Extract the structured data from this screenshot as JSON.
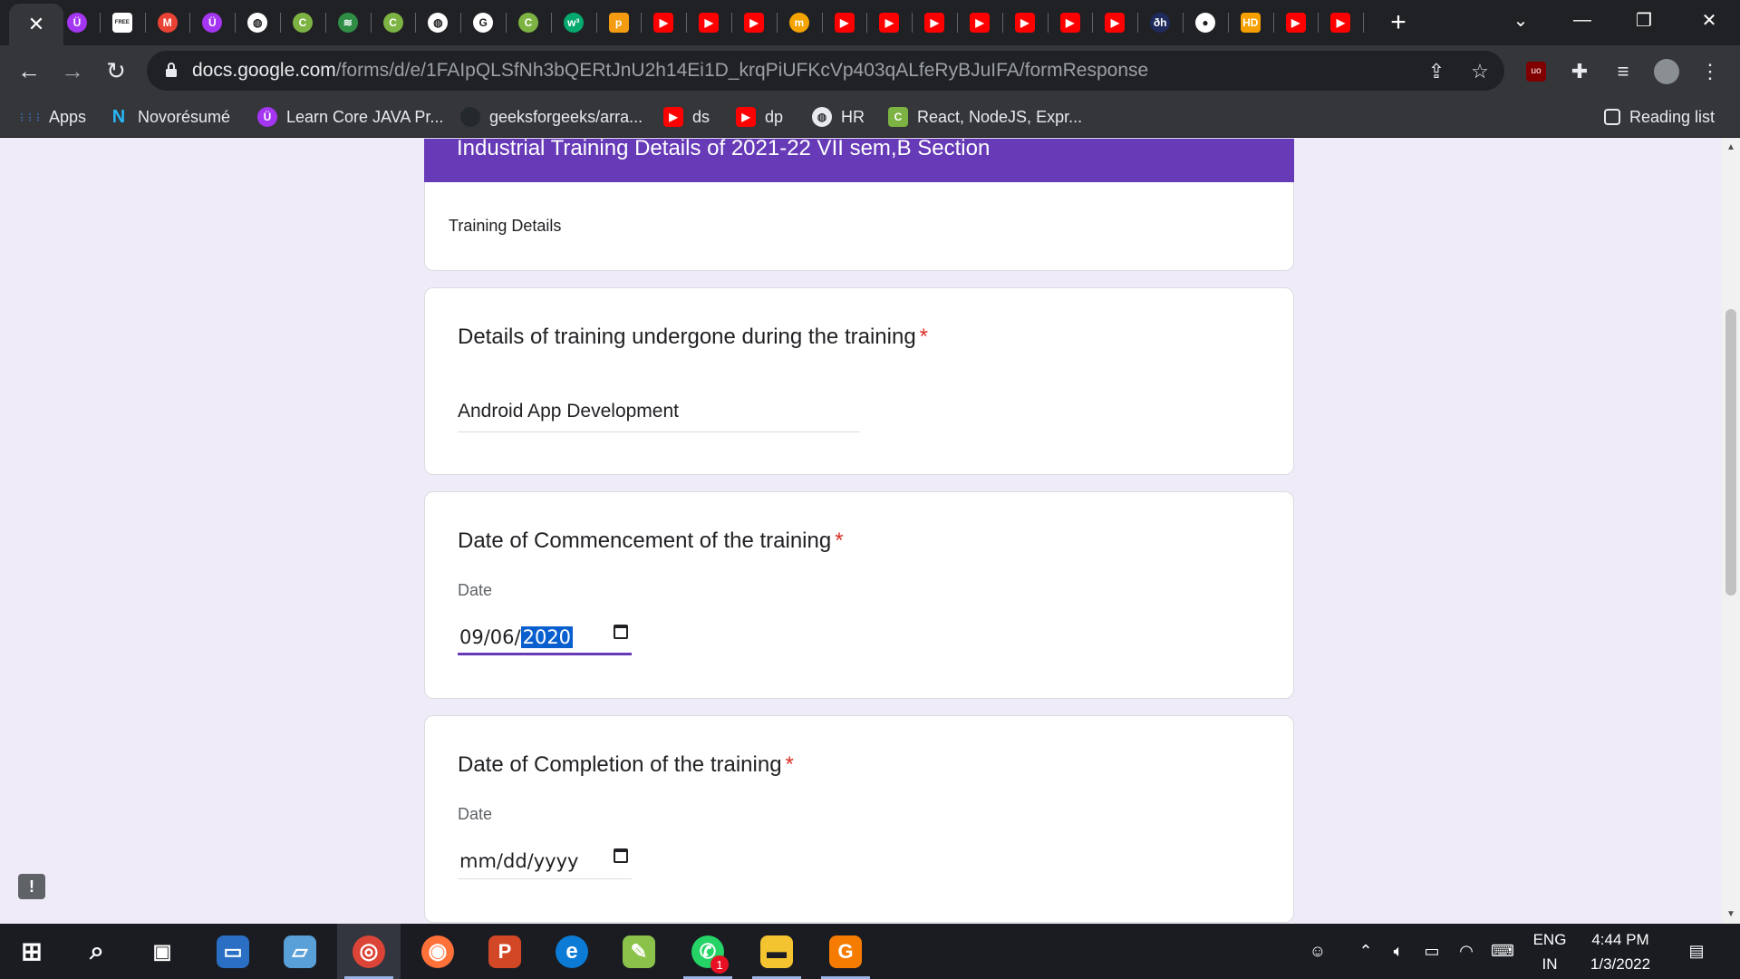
{
  "browser": {
    "tabs": [
      {
        "icon": "close-icon",
        "active": true
      },
      {
        "icon": "udemy-icon",
        "color": "#a435f0",
        "glyph": "Ü"
      },
      {
        "icon": "free-icon",
        "color": "#ffffff",
        "glyph": "FREE"
      },
      {
        "icon": "gmail-icon",
        "color": "#ea4335",
        "glyph": "M"
      },
      {
        "icon": "udemy-icon",
        "color": "#a435f0",
        "glyph": "Ü"
      },
      {
        "icon": "globe-icon",
        "color": "#ffffff",
        "glyph": "◍"
      },
      {
        "icon": "codecademy-icon",
        "color": "#7cb342",
        "glyph": "C"
      },
      {
        "icon": "gfg-icon",
        "color": "#2f8d46",
        "glyph": "≋"
      },
      {
        "icon": "codecademy-icon",
        "color": "#7cb342",
        "glyph": "C"
      },
      {
        "icon": "globe-icon",
        "color": "#ffffff",
        "glyph": "◍"
      },
      {
        "icon": "google-icon",
        "color": "#ffffff",
        "glyph": "G"
      },
      {
        "icon": "codecademy-icon",
        "color": "#7cb342",
        "glyph": "C"
      },
      {
        "icon": "w3schools-icon",
        "color": "#04aa6d",
        "glyph": "w³"
      },
      {
        "icon": "pdf-icon",
        "color": "#f39c12",
        "glyph": "p"
      },
      {
        "icon": "youtube-icon",
        "color": "#ff0000",
        "glyph": "▶"
      },
      {
        "icon": "youtube-icon",
        "color": "#ff0000",
        "glyph": "▶"
      },
      {
        "icon": "youtube-icon",
        "color": "#ff0000",
        "glyph": "▶"
      },
      {
        "icon": "coursera-icon",
        "color": "#f4a300",
        "glyph": "m"
      },
      {
        "icon": "youtube-icon",
        "color": "#ff0000",
        "glyph": "▶"
      },
      {
        "icon": "youtube-icon",
        "color": "#ff0000",
        "glyph": "▶"
      },
      {
        "icon": "youtube-icon",
        "color": "#ff0000",
        "glyph": "▶"
      },
      {
        "icon": "youtube-icon",
        "color": "#ff0000",
        "glyph": "▶"
      },
      {
        "icon": "youtube-icon",
        "color": "#ff0000",
        "glyph": "▶"
      },
      {
        "icon": "youtube-icon",
        "color": "#ff0000",
        "glyph": "▶"
      },
      {
        "icon": "youtube-icon",
        "color": "#ff0000",
        "glyph": "▶"
      },
      {
        "icon": "devhub-icon",
        "color": "#1f2a5c",
        "glyph": "ðh"
      },
      {
        "icon": "github-icon",
        "color": "#ffffff",
        "glyph": "●"
      },
      {
        "icon": "hd-icon",
        "color": "#f5a000",
        "glyph": "HD"
      },
      {
        "icon": "youtube-icon",
        "color": "#ff0000",
        "glyph": "▶"
      },
      {
        "icon": "youtube-icon",
        "color": "#ff0000",
        "glyph": "▶"
      }
    ],
    "new_tab_glyph": "+",
    "address": {
      "host": "docs.google.com",
      "path": "/forms/d/e/1FAIpQLSfNh3bQERtJnU2h14Ei1D_krqPiUFKcVp403qALfeRyBJuIFA/formResponse"
    },
    "bookmarks": [
      {
        "label": "Apps",
        "icon": "apps-grid-icon",
        "color": "#ea4335"
      },
      {
        "label": "Novorésumé",
        "icon": "novoresume-icon",
        "color": "#1e88e5"
      },
      {
        "label": "Learn Core JAVA Pr...",
        "icon": "udemy-icon",
        "color": "#a435f0"
      },
      {
        "label": "geeksforgeeks/arra...",
        "icon": "github-icon",
        "color": "#24292e"
      },
      {
        "label": "ds",
        "icon": "youtube-icon",
        "color": "#ff0000"
      },
      {
        "label": "dp",
        "icon": "youtube-icon",
        "color": "#ff0000"
      },
      {
        "label": "HR",
        "icon": "globe-icon",
        "color": "#35363a"
      },
      {
        "label": "React, NodeJS, Expr...",
        "icon": "codecademy-icon",
        "color": "#7cb342"
      }
    ],
    "reading_list": "Reading list"
  },
  "form": {
    "header_title": "Industrial Training Details of 2021-22 VII sem,B Section",
    "section_description": "Training Details",
    "required_mark": "*",
    "questions": [
      {
        "title": "Details of training undergone during the training",
        "answer": "Android App Development"
      },
      {
        "title": "Date of Commencement of the training",
        "date_label": "Date",
        "date_prefix": "09/06/",
        "date_selected": "2020"
      },
      {
        "title": "Date of Completion of the training",
        "date_label": "Date",
        "date_placeholder": "mm/dd/yyyy"
      }
    ]
  },
  "taskbar": {
    "apps": [
      {
        "icon": "windows-start-icon"
      },
      {
        "icon": "search-icon"
      },
      {
        "icon": "task-view-icon"
      },
      {
        "icon": "laptop-icon"
      },
      {
        "icon": "notes-icon"
      },
      {
        "icon": "chrome-icon",
        "running": true,
        "active": true
      },
      {
        "icon": "firefox-icon"
      },
      {
        "icon": "powerpoint-icon"
      },
      {
        "icon": "edge-icon"
      },
      {
        "icon": "notepadpp-icon"
      },
      {
        "icon": "whatsapp-icon",
        "running": true,
        "badge": "1"
      },
      {
        "icon": "file-explorer-icon",
        "running": true
      },
      {
        "icon": "pdf-tool-icon",
        "running": true
      }
    ],
    "language": "ENG",
    "region": "IN",
    "time": "4:44 PM",
    "date": "1/3/2022"
  }
}
